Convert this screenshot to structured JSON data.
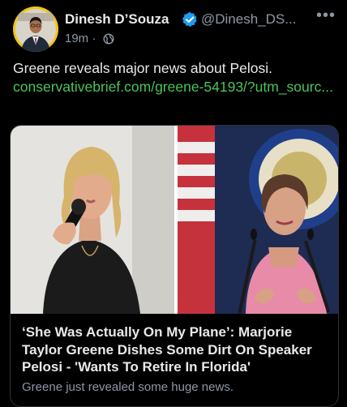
{
  "author": {
    "name": "Dinesh D’Souza",
    "handle": "@Dinesh_DS...",
    "verified": true,
    "avatar_icon": "avatar-portrait"
  },
  "post": {
    "time": "19m",
    "separator": "·",
    "audience_icon": "globe-icon",
    "text": "Greene reveals major news about Pelosi.",
    "link": "conservativebrief.com/greene-54193/?utm_sourc..."
  },
  "card": {
    "title": "‘She Was Actually On My Plane’: Marjorie Taylor Greene Dishes Some Dirt On Speaker Pelosi - 'Wants To Retire In Florida'",
    "description": "Greene just revealed some huge news."
  },
  "colors": {
    "background": "#000000",
    "text": "#e7e9ea",
    "secondary": "#8b98a5",
    "link": "#4cc35a",
    "verified": "#1d9bf0",
    "avatar_ring": "#f0c419"
  }
}
